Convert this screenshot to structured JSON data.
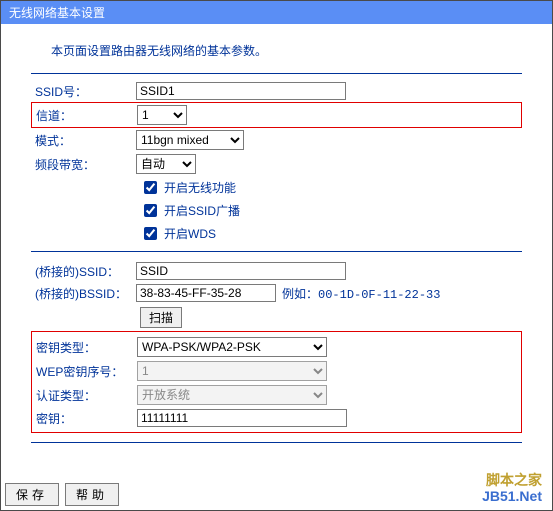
{
  "title": "无线网络基本设置",
  "intro": "本页面设置路由器无线网络的基本参数。",
  "labels": {
    "ssid": "SSID号：",
    "channel": "信道：",
    "mode": "模式：",
    "bandwidth": "频段带宽：",
    "bridge_ssid": "(桥接的)SSID：",
    "bridge_bssid": "(桥接的)BSSID：",
    "key_type": "密钥类型：",
    "wep_index": "WEP密钥序号：",
    "auth_type": "认证类型：",
    "key": "密钥："
  },
  "fields": {
    "ssid": "SSID1",
    "channel": "1",
    "mode": "11bgn mixed",
    "bandwidth": "自动",
    "bridge_ssid": "SSID",
    "bridge_bssid": "38-83-45-FF-35-28",
    "key_type": "WPA-PSK/WPA2-PSK",
    "wep_index": "1",
    "auth_type": "开放系统",
    "key": "11111111"
  },
  "checkboxes": {
    "enable_wireless": "开启无线功能",
    "enable_ssid_broadcast": "开启SSID广播",
    "enable_wds": "开启WDS"
  },
  "hints": {
    "bssid_example_prefix": "例如：",
    "bssid_example": "00-1D-0F-11-22-33"
  },
  "buttons": {
    "scan": "扫描",
    "save": "保存",
    "help": "帮助"
  },
  "watermark": {
    "line1": "脚本之家",
    "line2": "JB51.Net"
  }
}
